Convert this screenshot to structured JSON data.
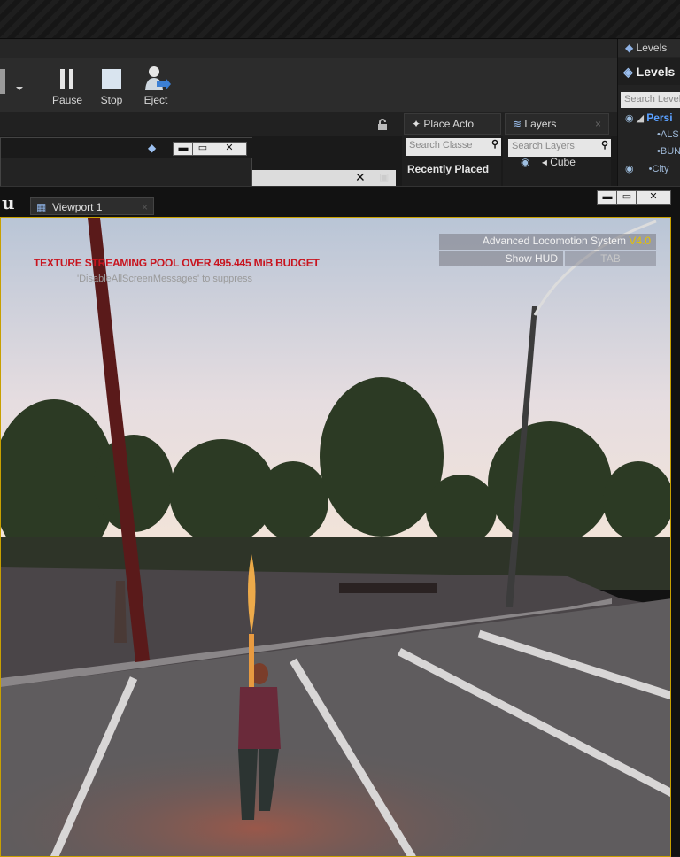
{
  "toolbar": {
    "pause_label": "Pause",
    "stop_label": "Stop",
    "eject_label": "Eject"
  },
  "levels": {
    "tab_label": "Levels",
    "header": "Levels",
    "search_placeholder": "Search Levels",
    "items": [
      {
        "label": "Persi"
      },
      {
        "label": "ALS"
      },
      {
        "label": "BUN"
      },
      {
        "label": "City"
      }
    ]
  },
  "place_actors": {
    "tab_label": "Place Acto",
    "search_placeholder": "Search Classe",
    "recently_placed": "Recently Placed"
  },
  "layers": {
    "tab_label": "Layers",
    "search_placeholder": "Search Layers",
    "items": [
      {
        "label": "Cube"
      }
    ]
  },
  "viewport": {
    "tab_label": "Viewport 1",
    "warning": "TEXTURE STREAMING POOL OVER 495.445 MiB BUDGET",
    "suppress_hint": "'DisableAllScreenMessages' to suppress",
    "hud_title": "Advanced Locomotion System",
    "hud_version": "V4.0",
    "hud_show_label": "Show HUD",
    "hud_key": "TAB"
  },
  "colors": {
    "accent_yellow": "#e6c200",
    "warning_red": "#c8141e",
    "level_blue": "#5aa0ff"
  }
}
